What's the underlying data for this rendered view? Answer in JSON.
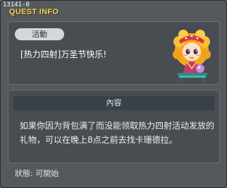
{
  "window": {
    "quest_id": "13141-0",
    "title": "QUEST INFO"
  },
  "quest": {
    "tag_label": "活動",
    "name": "[热力四射]万圣节快乐!",
    "npc_portrait_icon": "npc-girl-portrait-icon"
  },
  "details": {
    "header_label": "內容",
    "body": "如果你因为背包满了而没能领取热力四射活动发放的礼物，可以在晚上8点之前去找卡珊德拉。"
  },
  "status": {
    "text": "狀態:  可開始"
  },
  "colors": {
    "title": "#f3d34a",
    "window_bg": "#55595e",
    "panel_bg": "#494c51",
    "header_bg": "#384149"
  }
}
